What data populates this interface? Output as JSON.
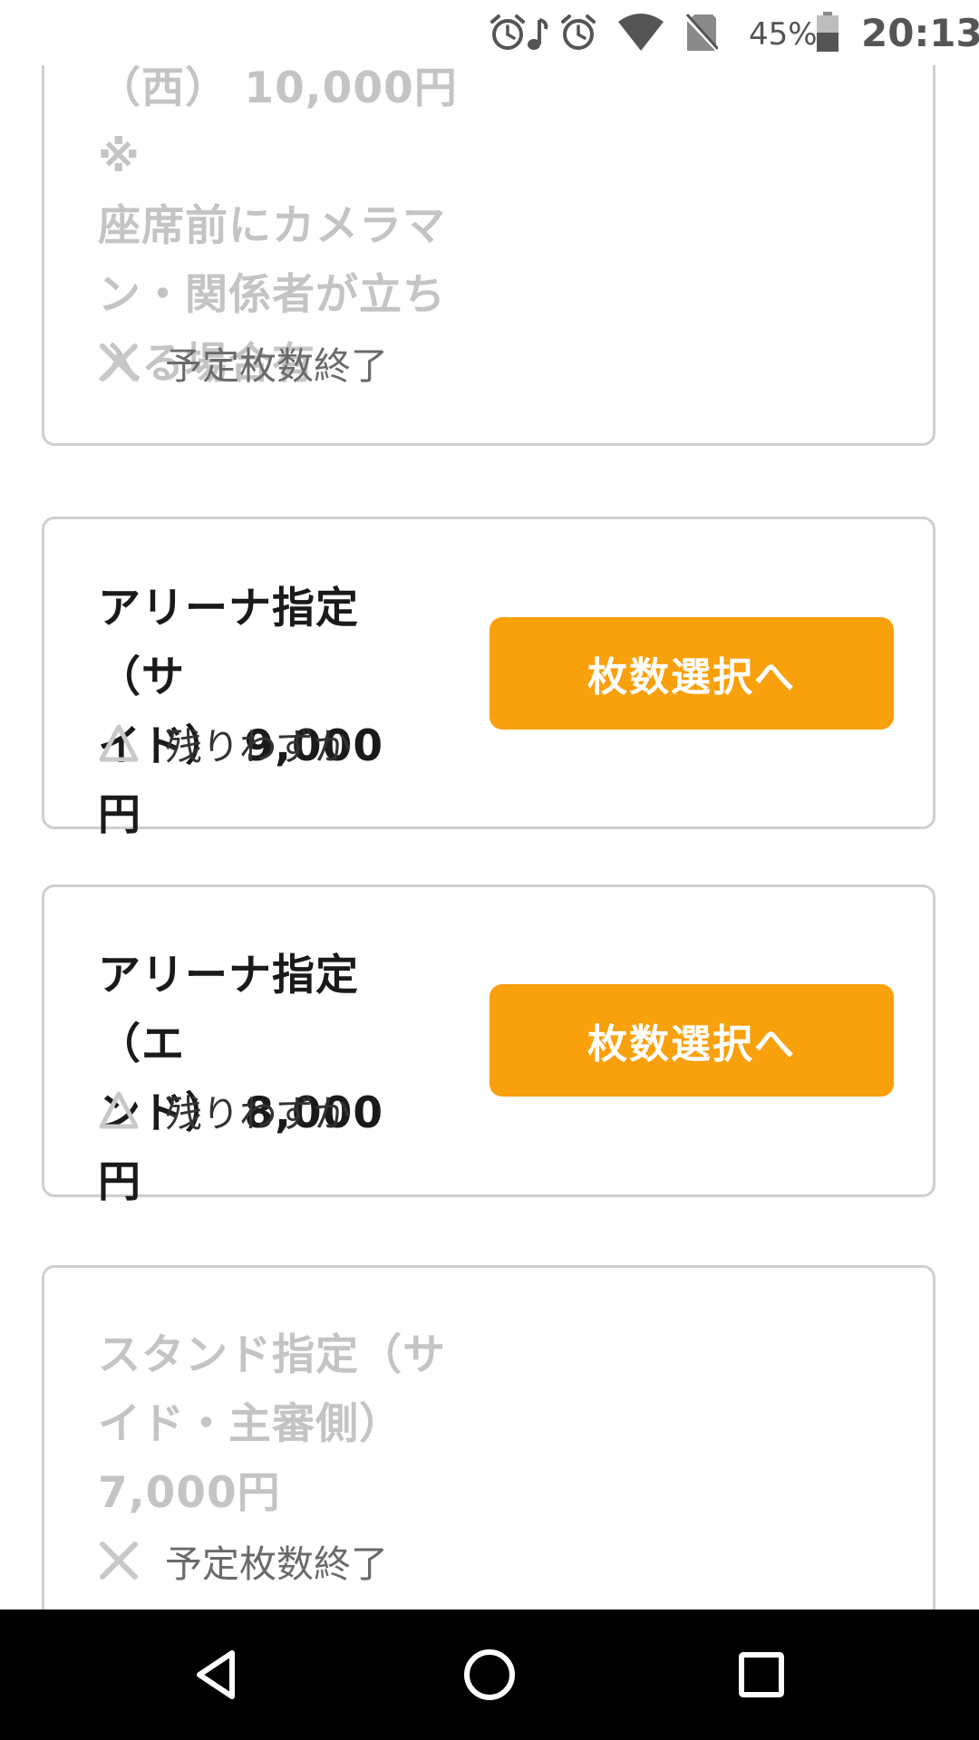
{
  "status_bar": {
    "battery_percent": "45%",
    "time": "20:13",
    "icons": [
      "alarm-icon",
      "music-note-icon",
      "alarm-icon",
      "wifi-icon",
      "no-sim-icon",
      "battery-icon"
    ]
  },
  "tickets": [
    {
      "name_lines": [
        "（西） 10,000円 ※",
        "座席前にカメラマ",
        "ン・関係者が立ち",
        "入る場合有"
      ],
      "status_icon": "cross-icon",
      "status_text": "予定枚数終了",
      "available": false
    },
    {
      "name_lines": [
        "アリーナ指定（サ",
        "イド） 9,000円"
      ],
      "status_icon": "triangle-icon",
      "status_text": "残りわずか",
      "available": true,
      "button_label": "枚数選択へ"
    },
    {
      "name_lines": [
        "アリーナ指定（エ",
        "ンド） 8,000円"
      ],
      "status_icon": "triangle-icon",
      "status_text": "残りわずか",
      "available": true,
      "button_label": "枚数選択へ"
    },
    {
      "name_lines": [
        "スタンド指定（サ",
        "イド・主審側）",
        "7,000円"
      ],
      "status_icon": "cross-icon",
      "status_text": "予定枚数終了",
      "available": false
    }
  ],
  "colors": {
    "button_bg": "#f9a00d",
    "card_border": "#cfcfcf",
    "disabled_text": "#c4c4c4",
    "navbar_bg": "#000000"
  },
  "nav_bar": {
    "buttons": [
      "back-icon",
      "home-icon",
      "recents-icon"
    ]
  }
}
